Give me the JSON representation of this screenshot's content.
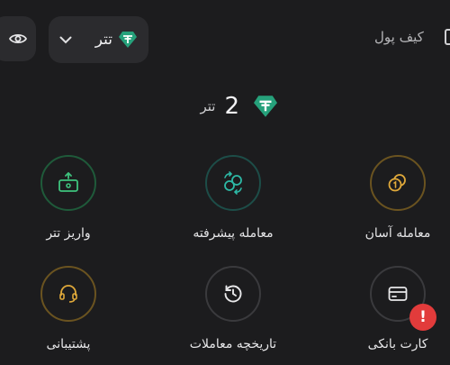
{
  "header": {
    "wallet_title": "کیف پول",
    "currency_label": "تتر"
  },
  "balance": {
    "amount": "2",
    "unit": "تتر"
  },
  "actions": [
    {
      "label": "واریز تتر"
    },
    {
      "label": "معامله پیشرفته"
    },
    {
      "label": "معامله آسان"
    },
    {
      "label": "پشتیبانی"
    },
    {
      "label": "تاریخچه معاملات"
    },
    {
      "label": "کارت بانکی",
      "badge": "!"
    }
  ],
  "colors": {
    "background": "#1c1c1e",
    "surface": "#2b2b2e",
    "tether": "#26a17b",
    "deposit_ring": "#1f5a3a",
    "advanced_ring": "#1d4d48",
    "easy_ring": "#6a5320",
    "support_ring": "#6a5320",
    "history_ring": "#3a3a3d",
    "card_ring": "#3a3a3d",
    "alert": "#e23b3b"
  }
}
